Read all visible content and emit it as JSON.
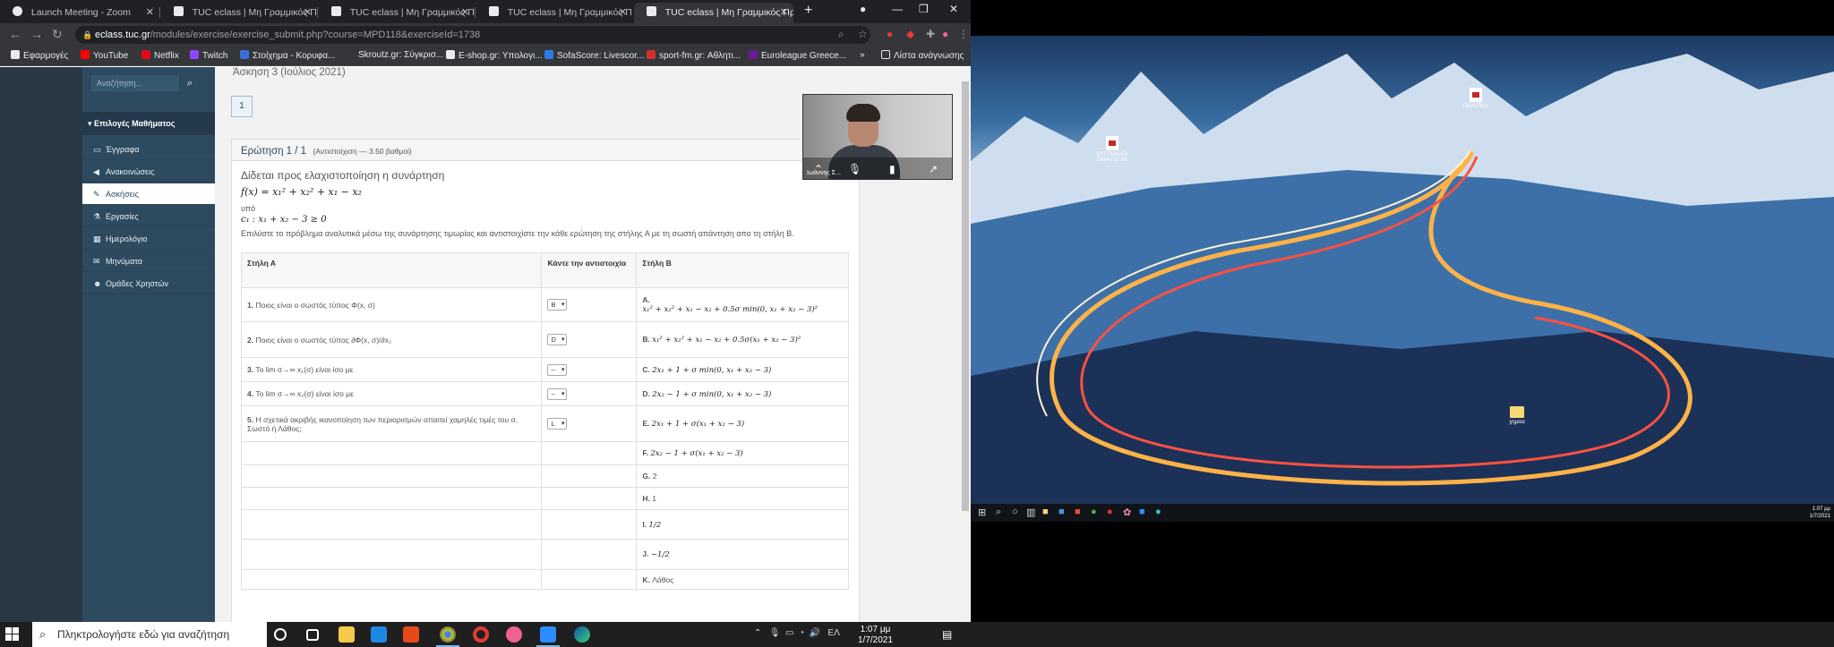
{
  "browser": {
    "tabs": [
      {
        "label": "Launch Meeting - Zoom"
      },
      {
        "label": "TUC eclass | Μη Γραμμικός Προ"
      },
      {
        "label": "TUC eclass | Μη Γραμμικός Προ"
      },
      {
        "label": "TUC eclass | Μη Γραμμικός Προ"
      },
      {
        "label": "TUC eclass | Μη Γραμμικός Προ"
      }
    ],
    "url_host": "eclass.tuc.gr",
    "url_path": "/modules/exercise/exercise_submit.php?course=MPD118&exerciseId=1738",
    "bookmarks": [
      {
        "label": "Εφαρμογές",
        "color": "#e8eaed"
      },
      {
        "label": "YouTube",
        "color": "#ff0000"
      },
      {
        "label": "Netflix",
        "color": "#e50914"
      },
      {
        "label": "Twitch",
        "color": "#9146ff"
      },
      {
        "label": "Στοίχημα - Κορυφα...",
        "color": "#3b6fd8"
      },
      {
        "label": "Skroutz.gr: Σύγκρισ...",
        "color": "#f68b24"
      },
      {
        "label": "E-shop.gr: Υπολογι...",
        "color": "#e8eaed"
      },
      {
        "label": "SofaScore: Livescor...",
        "color": "#2c7be5"
      },
      {
        "label": "sport-fm.gr: Αθλητι...",
        "color": "#d32f2f"
      },
      {
        "label": "Euroleague Greece...",
        "color": "#6a1b9a"
      }
    ],
    "reading_list": "Λίστα ανάγνωσης",
    "overflow": "»"
  },
  "sidebar": {
    "search_placeholder": "Αναζήτηση...",
    "header": "Επιλογές Μαθήματος",
    "items": [
      {
        "label": "Έγγραφα",
        "icon": "folder-icon"
      },
      {
        "label": "Ανακοινώσεις",
        "icon": "megaphone-icon"
      },
      {
        "label": "Ασκήσεις",
        "icon": "edit-icon"
      },
      {
        "label": "Εργασίες",
        "icon": "flask-icon"
      },
      {
        "label": "Ημερολόγιο",
        "icon": "calendar-icon"
      },
      {
        "label": "Μηνύματα",
        "icon": "envelope-icon"
      },
      {
        "label": "Ομάδες Χρηστών",
        "icon": "users-icon"
      }
    ]
  },
  "exercise": {
    "title": "Άσκηση 3 (Ιούλιος 2021)",
    "nav_question": "1",
    "question_header": "Ερώτηση 1 / 1",
    "question_sub": "(Αντιστοίχιση — 3.50 βαθμοί)",
    "lead": "Δίδεται προς ελαχιστοποίηση η συνάρτηση",
    "function": "f(x) = x₁² + x₂² + x₁ − x₂",
    "subject_to": "υπό",
    "constraint": "c₁ : x₁ + x₂ − 3 ≥ 0",
    "instructions": "Επιλύστε το πρόβλημα αναλυτικά μέσω της συνάρτησης τιμωρίας και αντιστοιχίστε την κάθε ερώτηση της στήλης Α με τη σωστή απάντηση απο τη στήλη Β."
  },
  "table": {
    "col_a": "Στήλη Α",
    "col_match": "Κάντε την αντιστοιχία",
    "col_b": "Στήλη Β",
    "rows": [
      {
        "a_num": "1.",
        "a_text": "Ποιος είναι ο σωστός τύπος Φ(x, σ)",
        "sel": "B",
        "b_letter": "A.",
        "b_text": "x₁² + x₂² + x₁ − x₂ + 0.5σ min(0, x₁ + x₂ − 3)²"
      },
      {
        "a_num": "2.",
        "a_text": "Ποιος είναι ο σωστός τύπος ∂Φ(x, σ)/∂x₂",
        "sel": "D",
        "b_letter": "B.",
        "b_text": "x₁² + x₂² + x₁ − x₂ + 0.5σ(x₁ + x₂ − 3)²"
      },
      {
        "a_num": "3.",
        "a_text": "Το lim σ→∞ x₁(σ) είναι ίσο με",
        "sel": "--",
        "b_letter": "C.",
        "b_text": "2x₁ + 1 + σ min(0, x₁ + x₂ − 3)"
      },
      {
        "a_num": "4.",
        "a_text": "Το lim σ→∞ x₂(σ) είναι ίσο με",
        "sel": "--",
        "b_letter": "D.",
        "b_text": "2x₂ − 1 + σ min(0, x₁ + x₂ − 3)"
      },
      {
        "a_num": "5.",
        "a_text": "Η σχετικά ακριβής ικανοποίηση των περιορισμών απαιτεί χαμηλές τιμές του σ. Σωστό ή Λάθος;",
        "sel": "L",
        "b_letter": "E.",
        "b_text": "2x₁ + 1 + σ(x₁ + x₂ − 3)"
      },
      {
        "a_num": "",
        "a_text": "",
        "sel": "",
        "b_letter": "F.",
        "b_text": "2x₂ − 1 + σ(x₁ + x₂ − 3)"
      },
      {
        "a_num": "",
        "a_text": "",
        "sel": "",
        "b_letter": "G.",
        "b_text": "2"
      },
      {
        "a_num": "",
        "a_text": "",
        "sel": "",
        "b_letter": "H.",
        "b_text": "1"
      },
      {
        "a_num": "",
        "a_text": "",
        "sel": "",
        "b_letter": "I.",
        "b_text": "1/2"
      },
      {
        "a_num": "",
        "a_text": "",
        "sel": "",
        "b_letter": "J.",
        "b_text": "−1/2"
      },
      {
        "a_num": "",
        "a_text": "",
        "sel": "",
        "b_letter": "K.",
        "b_text": "Λάθος"
      }
    ]
  },
  "zoom": {
    "participant": "Ιωάννης Σ..."
  },
  "desktop": {
    "icons": [
      {
        "label": "ΣΥΣΤΗΜΑΤΑ ΠΑΡΑΓΩΓΗΣ"
      },
      {
        "label": "ΠΟΛΙΤΙΚΑ"
      },
      {
        "label": "χημεια"
      }
    ],
    "clock_time": "1:07 μμ",
    "clock_date": "1/7/2021"
  },
  "taskbar": {
    "search_placeholder": "Πληκτρολογήστε εδώ για αναζήτηση",
    "lang": "ΕΛ",
    "time": "1:07 μμ",
    "date": "1/7/2021"
  }
}
